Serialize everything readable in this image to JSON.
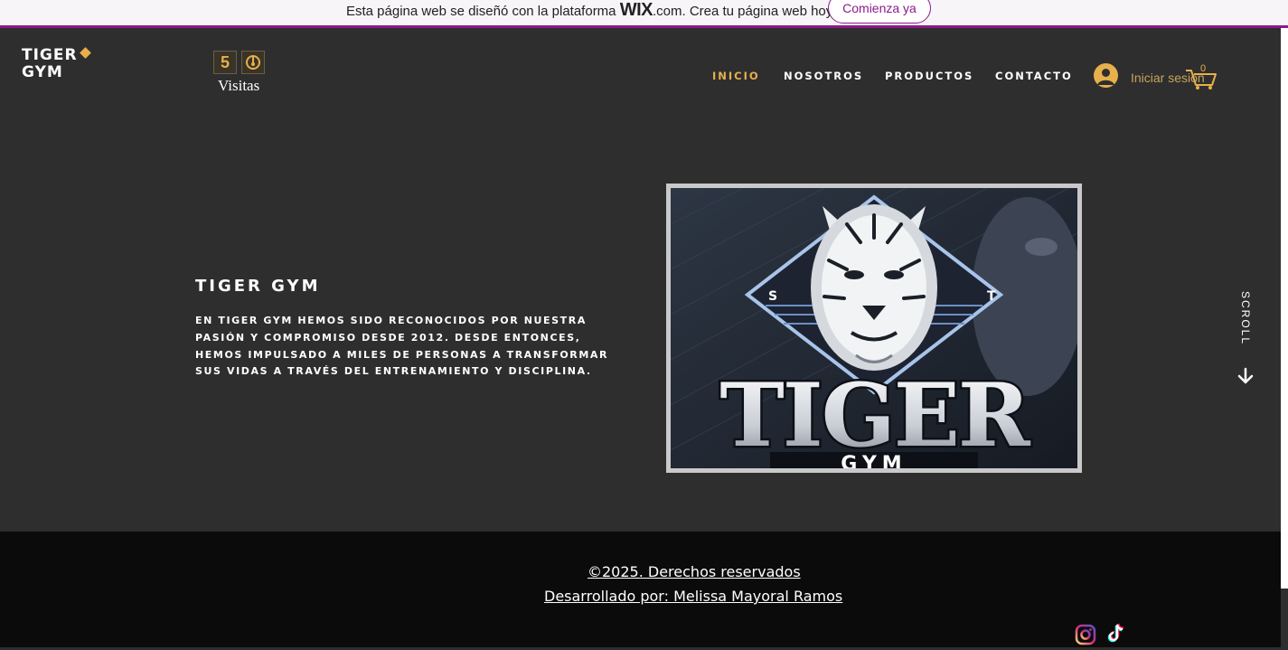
{
  "wix_banner": {
    "text_before": "Esta página web se diseñó con la plataforma ",
    "brand": "WIX",
    "text_after": ".com. Crea tu página web hoy.",
    "cta_label": "Comienza ya"
  },
  "header": {
    "logo_line1": "TIGER",
    "logo_line2": "GYM",
    "visit_count": "5",
    "visits_label": "Visitas",
    "nav": [
      "INICIO",
      "NOSOTROS",
      "PRODUCTOS",
      "CONTACTO"
    ],
    "login_label": "Iniciar sesión",
    "cart_count": "0"
  },
  "hero": {
    "title": "TIGER GYM",
    "description": "EN TIGER GYM HEMOS SIDO RECONOCIDOS POR NUESTRA PASIÓN Y COMPROMISO DESDE 2012. DESDE ENTONCES, HEMOS IMPULSADO A MILES DE PERSONAS A TRANSFORMAR SUS VIDAS A TRAVÉS DEL ENTRENAMIENTO Y DISCIPLINA.",
    "image_text_main": "TIGER",
    "image_text_sub": "GYM",
    "image_letter_left": "S",
    "image_letter_right": "T"
  },
  "scroll_label": "SCROLL",
  "footer": {
    "copyright": "©2025. Derechos reservados",
    "developer": "Desarrollado por: Melissa Mayoral Ramos"
  },
  "icons": {
    "instagram": "instagram-icon",
    "tiktok": "tiktok-icon",
    "cart": "shopping-cart-icon",
    "avatar": "user-avatar-icon",
    "scroll": "arrow-down-icon"
  },
  "colors": {
    "background": "#2e2e2f",
    "accent": "#e8b04a",
    "footer": "#0b0b0b",
    "wix_purple": "#8b1a8b"
  }
}
